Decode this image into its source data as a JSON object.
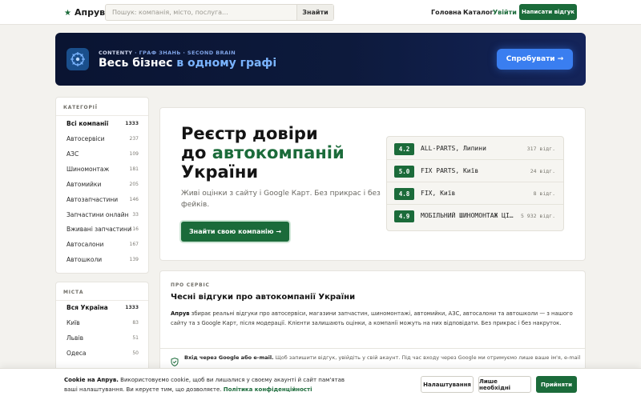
{
  "header": {
    "logo": "Апрув",
    "search_placeholder": "Пошук: компанія, місто, послуга...",
    "search_button": "Знайти",
    "nav": [
      {
        "label": "Головна",
        "active": false
      },
      {
        "label": "Каталог",
        "active": false
      },
      {
        "label": "Увійти",
        "active": true
      }
    ],
    "cta": "Написати відгук"
  },
  "banner": {
    "kicker_brand": "CONTENTY",
    "kicker_rest": "· ГРАФ ЗНАНЬ · SECOND BRAIN",
    "title_plain": "Весь бізнес",
    "title_highlight": "в одному графі",
    "button": "Спробувати →"
  },
  "categories": {
    "title": "КАТЕГОРІЇ",
    "items": [
      {
        "label": "Всі компанії",
        "count": "1333",
        "active": true
      },
      {
        "label": "Автосервіси",
        "count": "237",
        "active": false
      },
      {
        "label": "АЗС",
        "count": "109",
        "active": false
      },
      {
        "label": "Шиномонтаж",
        "count": "181",
        "active": false
      },
      {
        "label": "Автомийки",
        "count": "205",
        "active": false
      },
      {
        "label": "Автозапчастини",
        "count": "146",
        "active": false
      },
      {
        "label": "Запчастини онлайн",
        "count": "33",
        "active": false
      },
      {
        "label": "Вживані запчастини",
        "count": "116",
        "active": false
      },
      {
        "label": "Автосалони",
        "count": "167",
        "active": false
      },
      {
        "label": "Автошколи",
        "count": "139",
        "active": false
      }
    ]
  },
  "cities": {
    "title": "МІСТА",
    "items": [
      {
        "label": "Вся Україна",
        "count": "1333",
        "active": true
      },
      {
        "label": "Київ",
        "count": "83",
        "active": false
      },
      {
        "label": "Львів",
        "count": "51",
        "active": false
      },
      {
        "label": "Одеса",
        "count": "50",
        "active": false
      }
    ]
  },
  "hero": {
    "title_line1": "Реєстр довіри",
    "title_line2_plain": "до",
    "title_line2_green": "автокомпаній",
    "title_line3": "України",
    "subtitle": "Живі оцінки з сайту і Google Карт. Без прикрас і без фейків.",
    "button": "Знайти свою компанію →",
    "ratings": [
      {
        "score": "4.2",
        "name": "ALL-PARTS, Липини",
        "count": "317 відг."
      },
      {
        "score": "5.0",
        "name": "FIX PARTS, Київ",
        "count": "24 відг."
      },
      {
        "score": "4.8",
        "name": "FIX, Київ",
        "count": "8 відг."
      },
      {
        "score": "4.9",
        "name": "МОБІЛЬНИЙ ШИНОМОНТАЖ ЦІЛОДОБОВО",
        "count": "5 932 відг."
      }
    ]
  },
  "about": {
    "kicker": "ПРО СЕРВІС",
    "title": "Чесні відгуки про автокомпанії України",
    "text_brand": "Апрув",
    "text_body": "збирає реальні відгуки про автосервіси, магазини запчастин, шиномонтажі, автомийки, АЗС, автосалони та автошколи — з нашого сайту та з Google Карт, після модерації. Клієнти залишають оцінки, а компанії можуть на них відповідати. Без прикрас і без накруток.",
    "note_bold": "Вхід через Google або e-mail.",
    "note_body": "Щоб запишити відгук, увійдіть у свій акаунт. Під час входу через Google ми отримуємо лише ваше ім'я, e-mail і фото"
  },
  "cookie": {
    "bold": "Cookie на Апрув.",
    "text": "Використовуємо cookie, щоб ви лишалися у своєму акаунті й сайт пам'ятав ваші налаштування. Ви керуєте тим, що дозволяєте.",
    "link": "Політика конфіденційності",
    "btn_settings": "Налаштування",
    "btn_necessary": "Лише необхідні",
    "btn_accept": "Прийняти"
  },
  "colors": {
    "brand_green": "#1b6b3a",
    "banner_bg": "#0d1a3c",
    "banner_accent": "#3a7ef0"
  }
}
